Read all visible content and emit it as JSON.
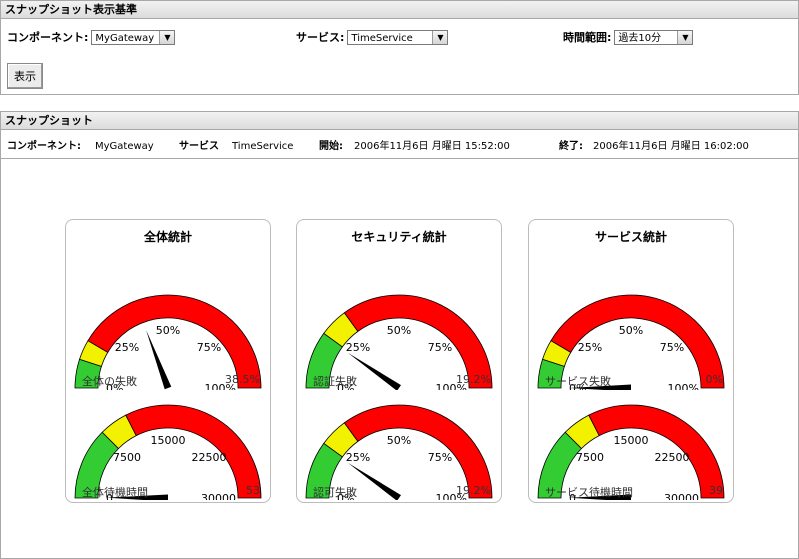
{
  "criteria": {
    "header": "スナップショット表示基準",
    "component_label": "コンポーネント:",
    "component_value": "MyGateway",
    "service_label": "サービス:",
    "service_value": "TimeService",
    "range_label": "時間範囲:",
    "range_value": "過去10分",
    "show_button": "表示"
  },
  "snapshot": {
    "header": "スナップショット",
    "component_label": "コンポーネント:",
    "component_value": "MyGateway",
    "service_label": "サービス",
    "service_value": "TimeService",
    "start_label": "開始:",
    "start_value": "2006年11月6日 月曜日 15:52:00",
    "end_label": "終了:",
    "end_value": "2006年11月6日 月曜日 16:02:00"
  },
  "colors": {
    "green": "#33cc33",
    "yellow": "#f2f200",
    "red": "#ff0000"
  },
  "panels": [
    {
      "title": "全体統計",
      "gauges": [
        {
          "label": "全体の失敗",
          "value_text": "38.5%",
          "max": 100,
          "value": 38.5,
          "green_to": 10,
          "yellow_to": 17,
          "ticks": [
            "0%",
            "25%",
            "50%",
            "75%",
            "100%"
          ]
        },
        {
          "label": "全体待機時間",
          "value_text": "53",
          "max": 30000,
          "value": 53,
          "green_to": 7500,
          "yellow_to": 10500,
          "ticks": [
            "0",
            "7500",
            "15000",
            "22500",
            "30000"
          ]
        }
      ]
    },
    {
      "title": "セキュリティ統計",
      "gauges": [
        {
          "label": "認証失敗",
          "value_text": "19.2%",
          "max": 100,
          "value": 19.2,
          "green_to": 20,
          "yellow_to": 30,
          "ticks": [
            "0%",
            "25%",
            "50%",
            "75%",
            "100%"
          ]
        },
        {
          "label": "認可失敗",
          "value_text": "19.2%",
          "max": 100,
          "value": 19.2,
          "green_to": 20,
          "yellow_to": 30,
          "ticks": [
            "0%",
            "25%",
            "50%",
            "75%",
            "100%"
          ]
        }
      ]
    },
    {
      "title": "サービス統計",
      "gauges": [
        {
          "label": "サービス失敗",
          "value_text": "0%",
          "max": 100,
          "value": 0,
          "green_to": 10,
          "yellow_to": 17,
          "ticks": [
            "0%",
            "25%",
            "50%",
            "75%",
            "100%"
          ]
        },
        {
          "label": "サービス待機時間",
          "value_text": "39",
          "max": 30000,
          "value": 39,
          "green_to": 7500,
          "yellow_to": 10500,
          "ticks": [
            "0",
            "7500",
            "15000",
            "22500",
            "30000"
          ]
        }
      ]
    }
  ]
}
